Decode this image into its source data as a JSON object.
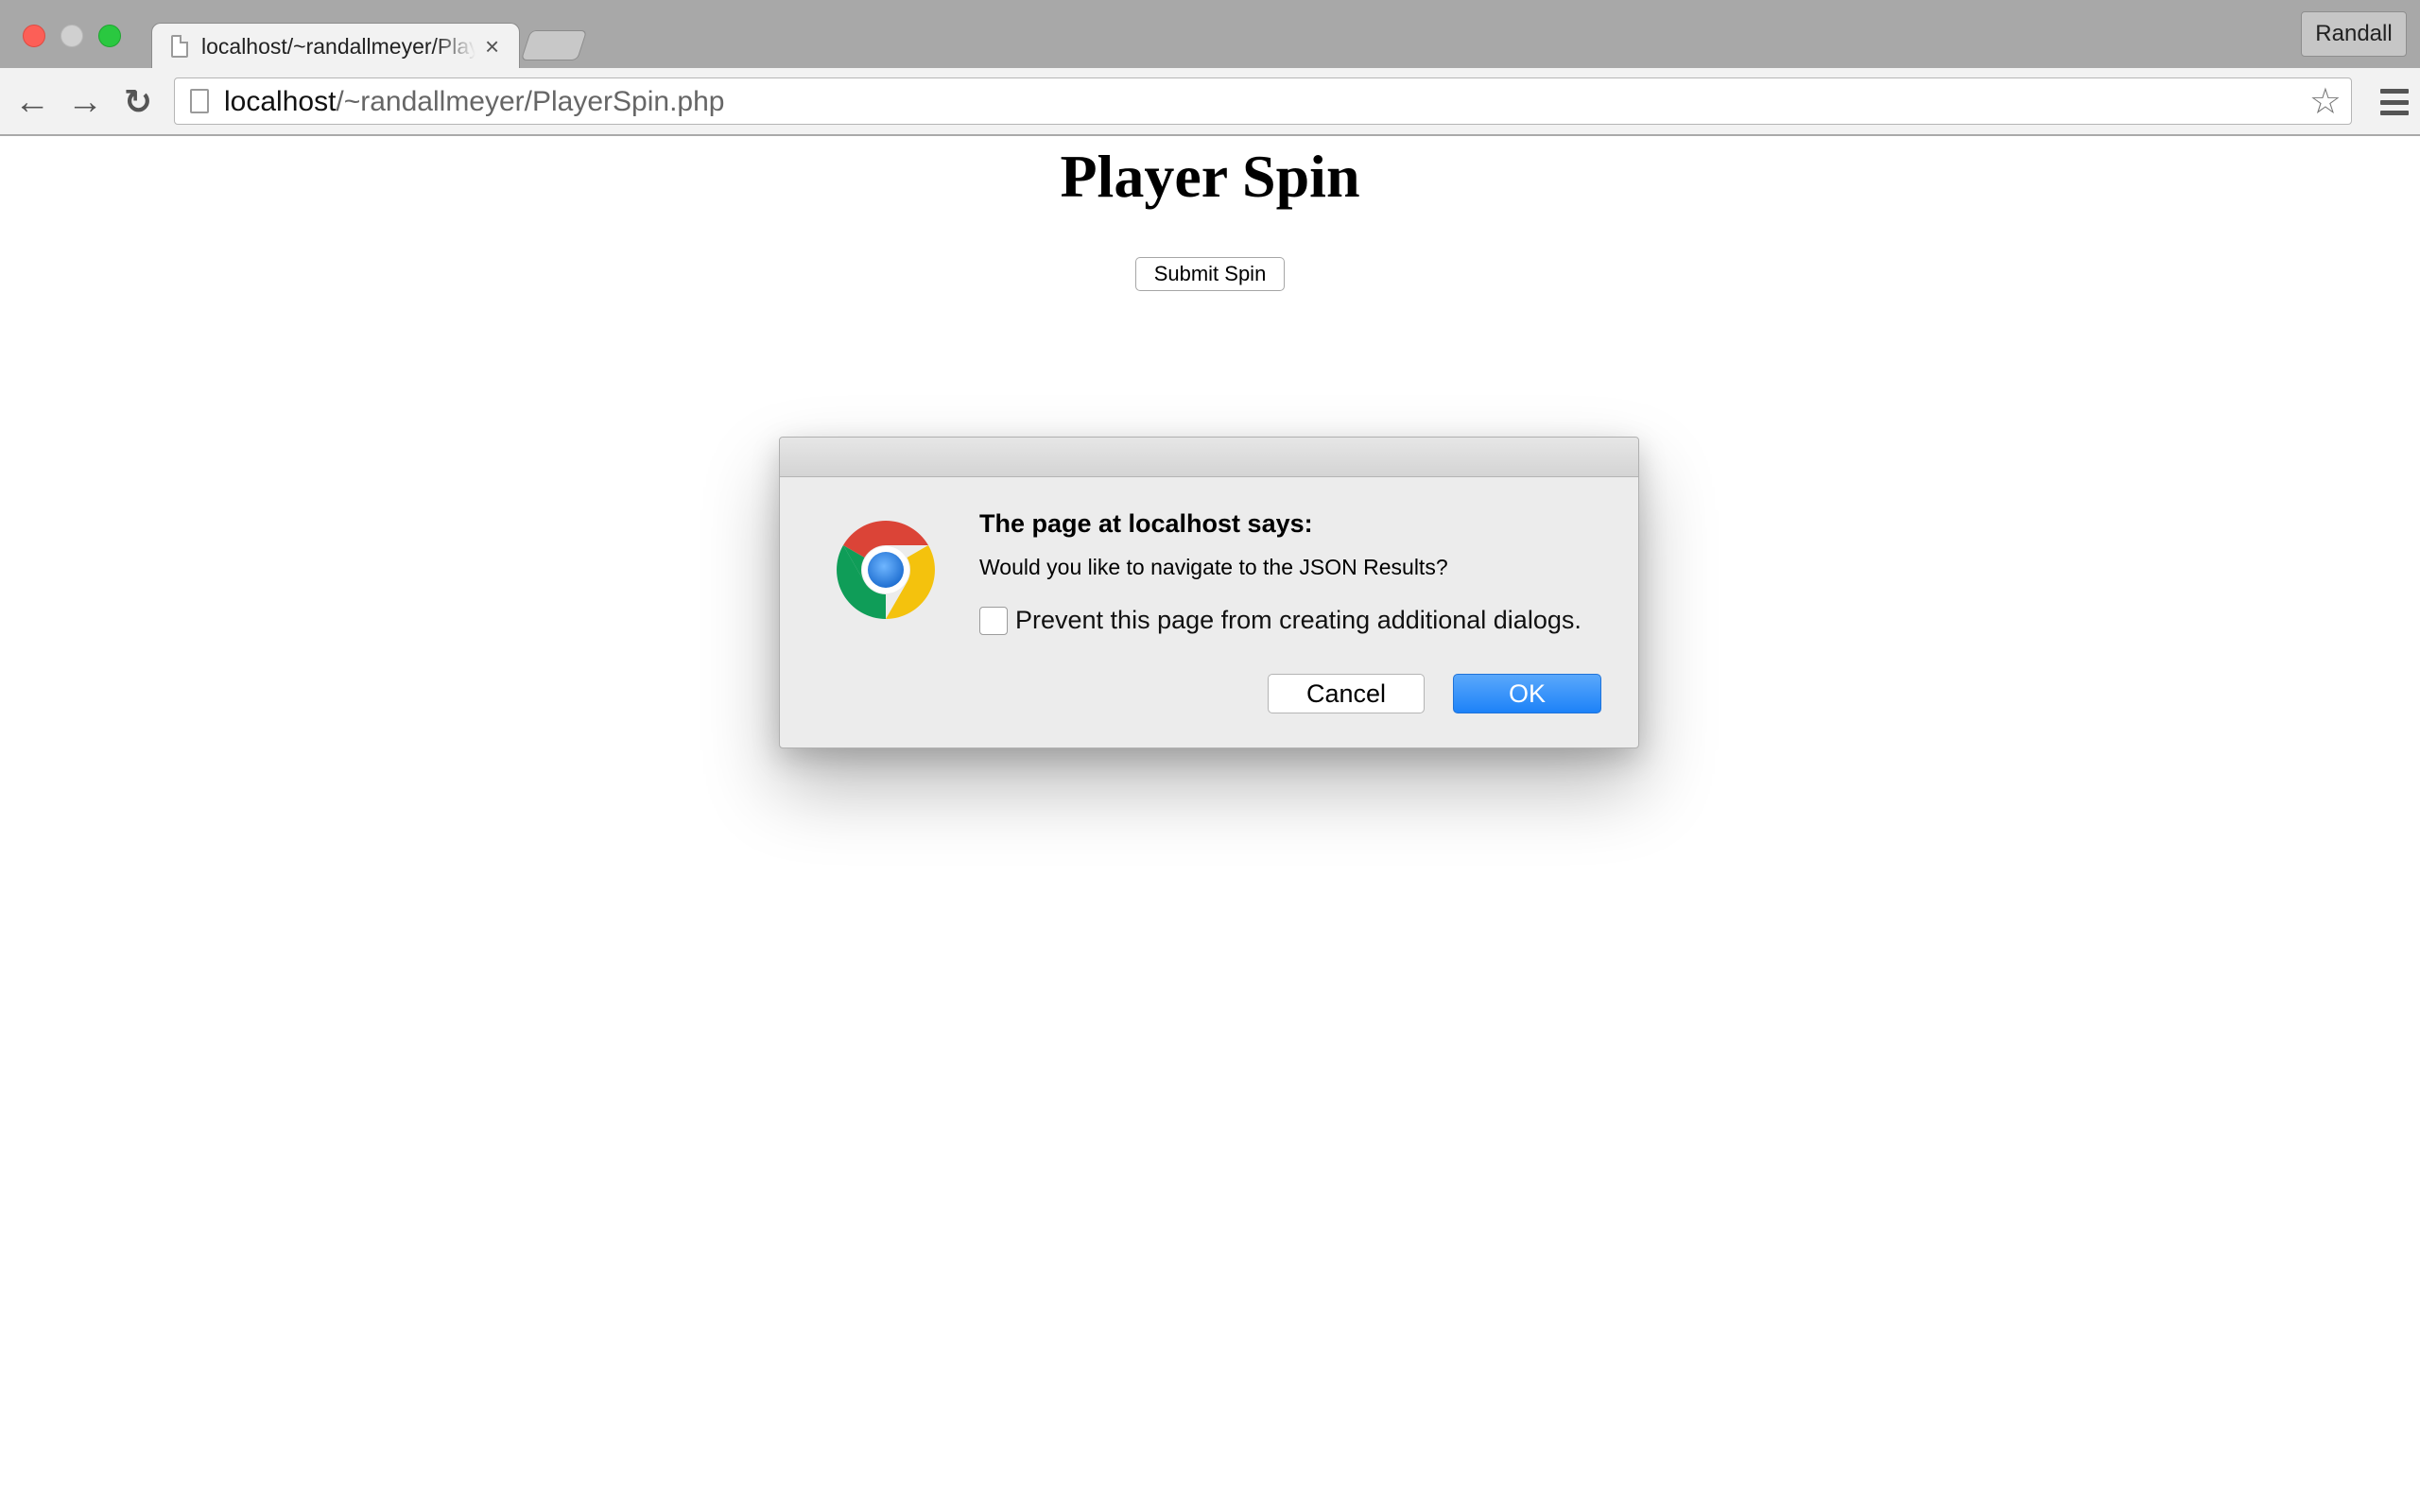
{
  "browser": {
    "tab": {
      "title": "localhost/~randallmeyer/PlayerSpin.php",
      "close_glyph": "×"
    },
    "profile_name": "Randall",
    "address_bar": {
      "host": "localhost",
      "path": "/~randallmeyer/PlayerSpin.php"
    },
    "icons": {
      "back": "←",
      "forward": "→",
      "reload": "↻",
      "bookmark_star": "☆"
    }
  },
  "page": {
    "title": "Player Spin",
    "submit_button_label": "Submit Spin"
  },
  "dialog": {
    "heading": "The page at localhost says:",
    "message": "Would you like to navigate to the JSON Results?",
    "prevent_label": "Prevent this page from creating additional dialogs.",
    "prevent_checked": false,
    "cancel_label": "Cancel",
    "ok_label": "OK",
    "ok_color": "#2b8cf9"
  }
}
